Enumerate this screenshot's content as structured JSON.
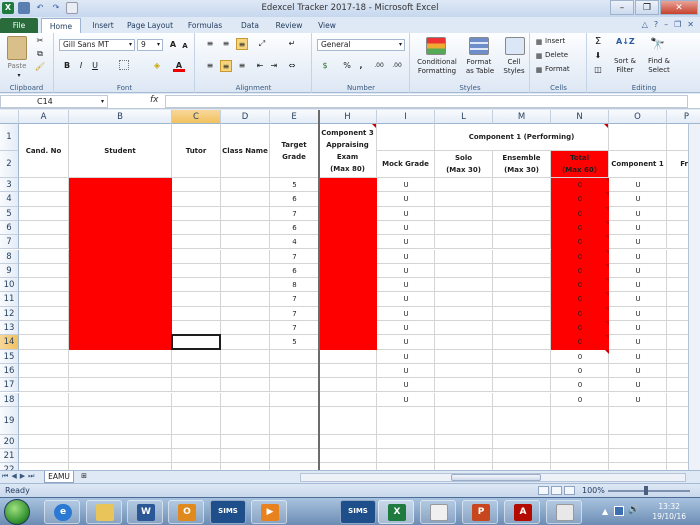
{
  "window": {
    "title": "Edexcel Tracker 2017-18  -  Microsoft Excel"
  },
  "qat": [
    "save-icon",
    "undo-icon",
    "redo-icon",
    "print-preview-icon"
  ],
  "ribbon_tabs": [
    "File",
    "Home",
    "Insert",
    "Page Layout",
    "Formulas",
    "Data",
    "Review",
    "View"
  ],
  "ribbon": {
    "clipboard": {
      "paste": "Paste",
      "label": "Clipboard"
    },
    "font": {
      "name": "Gill Sans MT",
      "size": "9",
      "label": "Font",
      "bold": "B",
      "italic": "I",
      "underline": "U",
      "grow": "A",
      "shrink": "A",
      "font_color": "A"
    },
    "alignment": {
      "label": "Alignment"
    },
    "number": {
      "format": "General",
      "label": "Number",
      "percent": "%",
      "comma": ",",
      "inc_dec": ".00",
      "dec_dec": ".00"
    },
    "styles": {
      "conditional": "Conditional",
      "conditional2": "Formatting",
      "format": "Format",
      "format2": "as Table",
      "cell": "Cell",
      "cell2": "Styles",
      "label": "Styles"
    },
    "cells": {
      "insert": "Insert",
      "delete": "Delete",
      "format": "Format",
      "label": "Cells"
    },
    "editing": {
      "sum": "Σ",
      "sort": "Sort &",
      "sort2": "Filter",
      "find": "Find &",
      "find2": "Select",
      "label": "Editing"
    }
  },
  "formula_bar": {
    "cell_ref": "C14",
    "fx": "fx",
    "value": ""
  },
  "columns": [
    "A",
    "B",
    "C",
    "D",
    "E",
    "H",
    "I",
    "L",
    "M",
    "N",
    "O",
    "P"
  ],
  "rows": [
    "1",
    "2",
    "3",
    "4",
    "5",
    "6",
    "7",
    "8",
    "9",
    "10",
    "11",
    "12",
    "13",
    "14",
    "15",
    "16",
    "17",
    "18",
    "19",
    "20",
    "21",
    "22"
  ],
  "headers": {
    "cand_no": "Cand. No",
    "student": "Student",
    "tutor": "Tutor",
    "class_name": "Class Name",
    "target_grade_1": "Target",
    "target_grade_2": "Grade",
    "comp3_1": "Component 3",
    "comp3_2": "Appraising",
    "comp3_3": "Exam",
    "comp3_4": "(Max 80)",
    "mock_grade": "Mock Grade",
    "comp1_performing": "Component 1 (Performing)",
    "solo": "Solo",
    "solo_max": "(Max 30)",
    "ensemble": "Ensemble",
    "ensemble_max": "(Max 30)",
    "total": "Total",
    "total_max": "(Max 60)",
    "component1": "Component 1",
    "col_p_partial": "Fre"
  },
  "target_grades": [
    "5",
    "6",
    "7",
    "6",
    "4",
    "7",
    "6",
    "8",
    "7",
    "7",
    "7",
    "5"
  ],
  "mock_grades": [
    "U",
    "U",
    "U",
    "U",
    "U",
    "U",
    "U",
    "U",
    "U",
    "U",
    "U",
    "U",
    "U",
    "U",
    "U",
    "U"
  ],
  "totals": [
    "0",
    "0",
    "0",
    "0",
    "0",
    "0",
    "0",
    "0",
    "0",
    "0",
    "0",
    "0",
    "0",
    "0",
    "0",
    "0"
  ],
  "component1_grades": [
    "U",
    "U",
    "U",
    "U",
    "U",
    "U",
    "U",
    "U",
    "U",
    "U",
    "U",
    "U",
    "U",
    "U",
    "U",
    "U"
  ],
  "sheet_tabs": [
    "EAMU"
  ],
  "status": {
    "text": "Ready",
    "zoom": "100%"
  },
  "taskbar": {
    "apps": [
      "ie-icon",
      "explorer-icon",
      "word-icon",
      "outlook-icon",
      "sims-app",
      "media-icon",
      "sims-app",
      "excel-icon",
      "notes-icon",
      "powerpoint-icon",
      "acrobat-icon",
      "notepad-icon"
    ],
    "sims_label": "SIMS",
    "time": "13:32",
    "date": "19/10/16"
  },
  "colors": {
    "highlight": "#ff0000",
    "excel_green": "#1f7a3e"
  }
}
